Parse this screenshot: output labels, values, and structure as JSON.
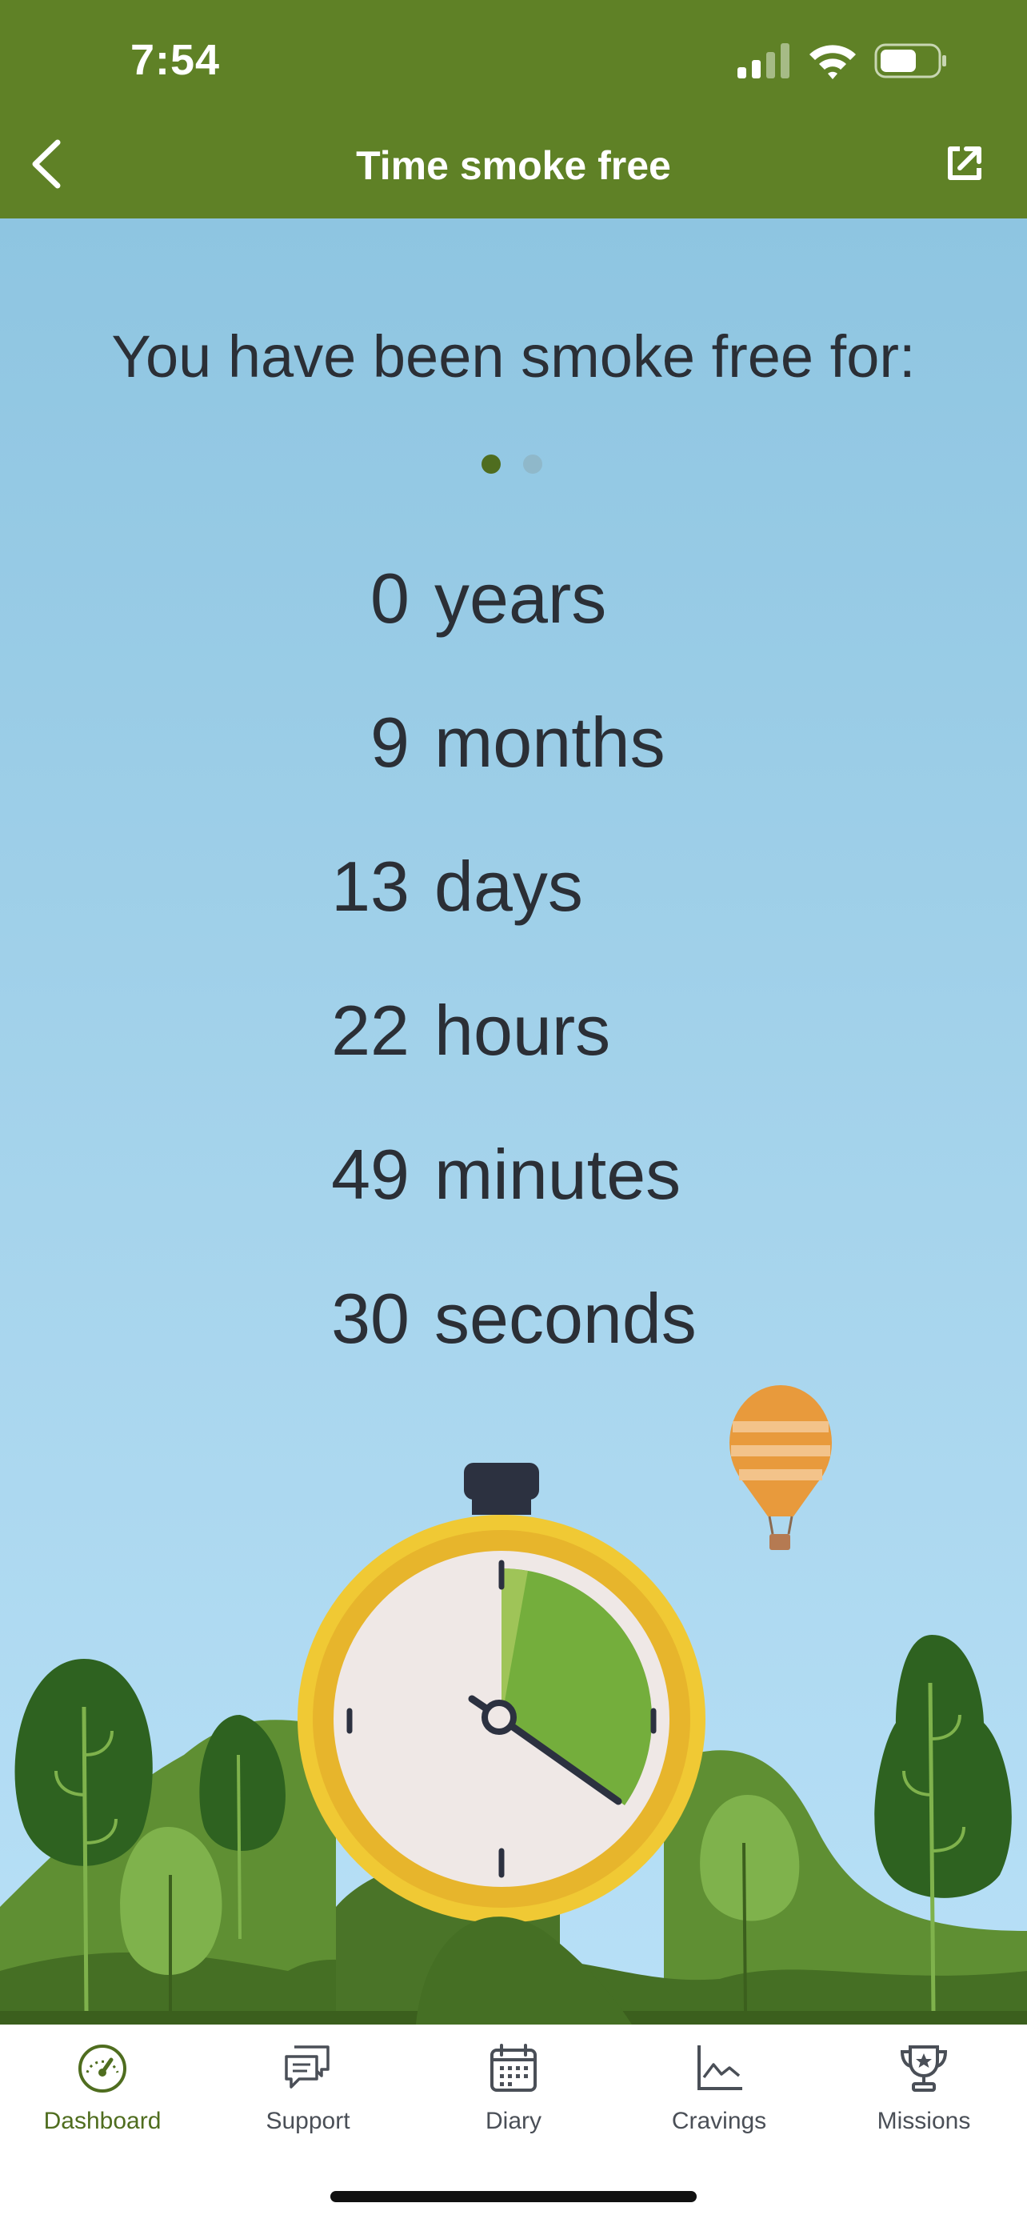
{
  "status": {
    "time": "7:54"
  },
  "header": {
    "title": "Time smoke free"
  },
  "main": {
    "intro": "You have been smoke free for:",
    "rows": [
      {
        "value": "0",
        "unit": "years"
      },
      {
        "value": "9",
        "unit": "months"
      },
      {
        "value": "13",
        "unit": "days"
      },
      {
        "value": "22",
        "unit": "hours"
      },
      {
        "value": "49",
        "unit": "minutes"
      },
      {
        "value": "30",
        "unit": "seconds"
      }
    ],
    "page_indicator": {
      "current": 1,
      "total": 2
    }
  },
  "nav": {
    "items": [
      {
        "label": "Dashboard",
        "icon": "dashboard-gauge-icon",
        "active": true
      },
      {
        "label": "Support",
        "icon": "chat-bubbles-icon",
        "active": false
      },
      {
        "label": "Diary",
        "icon": "calendar-icon",
        "active": false
      },
      {
        "label": "Cravings",
        "icon": "line-chart-icon",
        "active": false
      },
      {
        "label": "Missions",
        "icon": "trophy-icon",
        "active": false
      }
    ]
  },
  "colors": {
    "header_bg": "#5f8126",
    "active_accent": "#4f6d1f",
    "text_dark": "#2b2f36"
  }
}
